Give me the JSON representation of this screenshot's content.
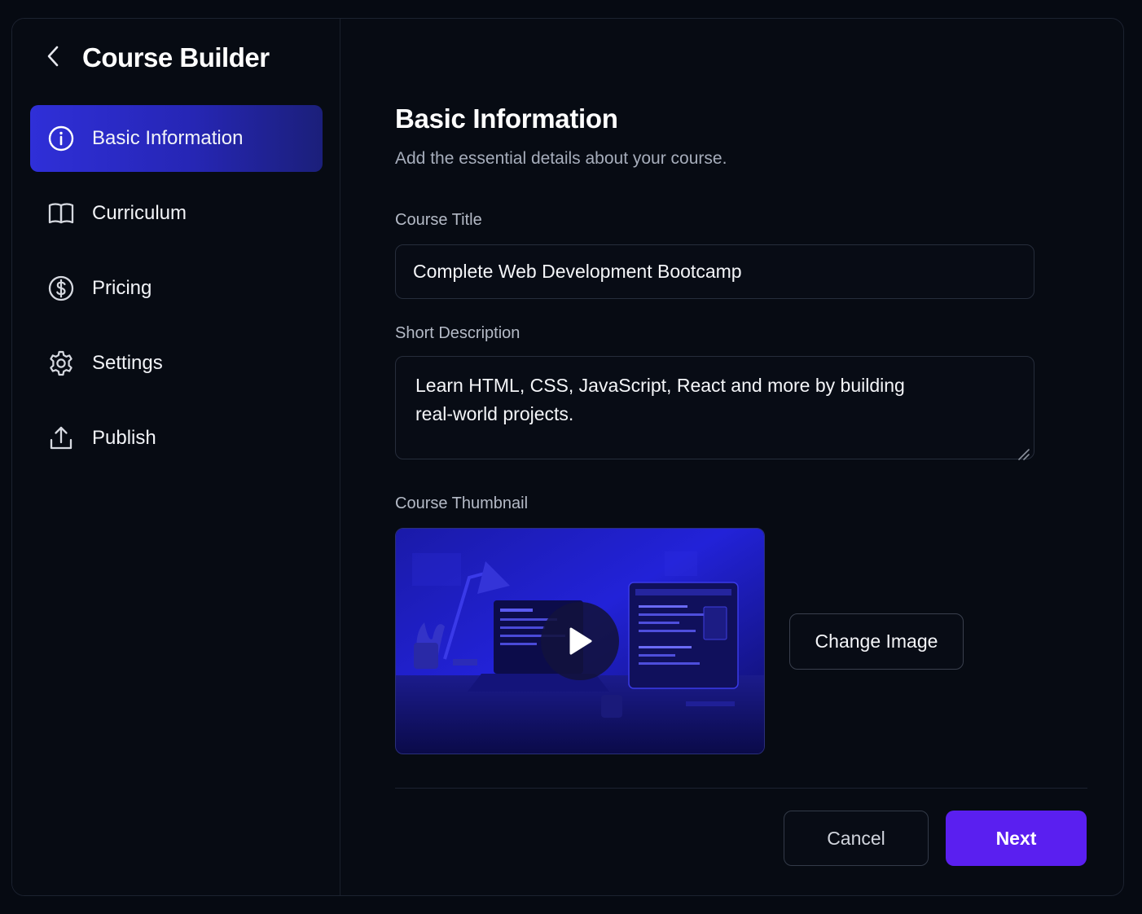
{
  "sidebar": {
    "title": "Course Builder",
    "items": [
      {
        "label": "Basic Information",
        "icon": "info-icon",
        "active": true
      },
      {
        "label": "Curriculum",
        "icon": "book-icon",
        "active": false
      },
      {
        "label": "Pricing",
        "icon": "dollar-circle-icon",
        "active": false
      },
      {
        "label": "Settings",
        "icon": "gear-icon",
        "active": false
      },
      {
        "label": "Publish",
        "icon": "upload-icon",
        "active": false
      }
    ]
  },
  "main": {
    "title": "Basic Information",
    "subtitle": "Add the essential details about your course.",
    "course_title_label": "Course Title",
    "course_title_value": "Complete Web Development Bootcamp",
    "short_description_label": "Short Description",
    "short_description_value": "Learn HTML, CSS, JavaScript, React and more by building real-world projects.",
    "thumbnail_label": "Course Thumbnail",
    "change_image_label": "Change Image",
    "cancel_label": "Cancel",
    "next_label": "Next"
  },
  "colors": {
    "accent": "#5a1ff0",
    "active_nav": "#2f2fd8",
    "background": "#070b13"
  }
}
